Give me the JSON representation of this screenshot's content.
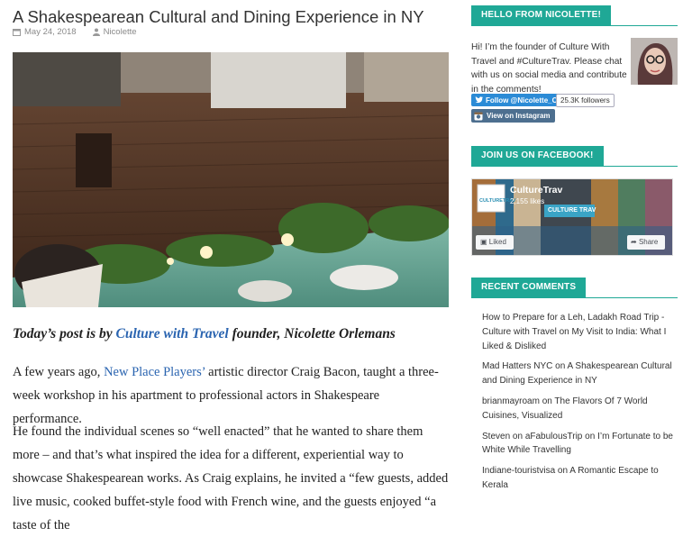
{
  "post": {
    "title": "A Shakespearean Cultural and Dining Experience in NY",
    "date": "May 24, 2018",
    "author": "Nicolette",
    "intro_prefix": "Today’s post is by ",
    "intro_link": "Culture with Travel",
    "intro_suffix": " founder, Nicolette Orlemans",
    "p1_link": "New Place Players’",
    "p1_text": " artistic director Craig Bacon, taught a three-week workshop in his apartment to professional actors in Shakespeare performance.",
    "p2_text": "He found the individual scenes so “well enacted” that he wanted to share them more – and that’s what inspired the idea for a different, experiential way to showcase Shakespearean works. As Craig explains, he invited a “few guests, added live music, cooked buffet-style food with French wine, and the guests enjoyed “a taste of the"
  },
  "sidebar": {
    "hello": {
      "heading": "HELLO FROM NICOLETTE!",
      "text": "Hi! I’m the founder of Culture With Travel and #CultureTrav. Please chat with us on social media and contribute in the comments!",
      "twitter_label": "Follow @Nicolette_O",
      "twitter_count": "25.3K followers",
      "instagram_label": "View on Instagram"
    },
    "facebook": {
      "heading": "JOIN US ON FACEBOOK!",
      "page_name": "CultureTrav",
      "likes": "2,155 likes",
      "logo_text": "CULTURETRAV",
      "cover_text": "CULTURE TRAV",
      "liked_label": "Liked",
      "share_label": "Share"
    },
    "recent": {
      "heading": "RECENT COMMENTS",
      "items": [
        {
          "author": "How to Prepare for a Leh, Ladakh Road Trip - Culture with Travel",
          "on": " on ",
          "post": "My Visit to India: What I Liked & Disliked"
        },
        {
          "author": "Mad Hatters NYC",
          "on": " on ",
          "post": "A Shakespearean Cultural and Dining Experience in NY"
        },
        {
          "author": "brianmayroam",
          "on": " on ",
          "post": "The Flavors Of 7 World Cuisines, Visualized"
        },
        {
          "author": "Steven on aFabulousTrip",
          "on": " on ",
          "post": "I’m Fortunate to be White While Travelling"
        },
        {
          "author": "Indiane-touristvisa",
          "on": " on ",
          "post": "A Romantic Escape to Kerala"
        }
      ]
    }
  },
  "colors": {
    "accent": "#1fa896",
    "link": "#2a64b0",
    "twitter": "#2b8bd6"
  }
}
